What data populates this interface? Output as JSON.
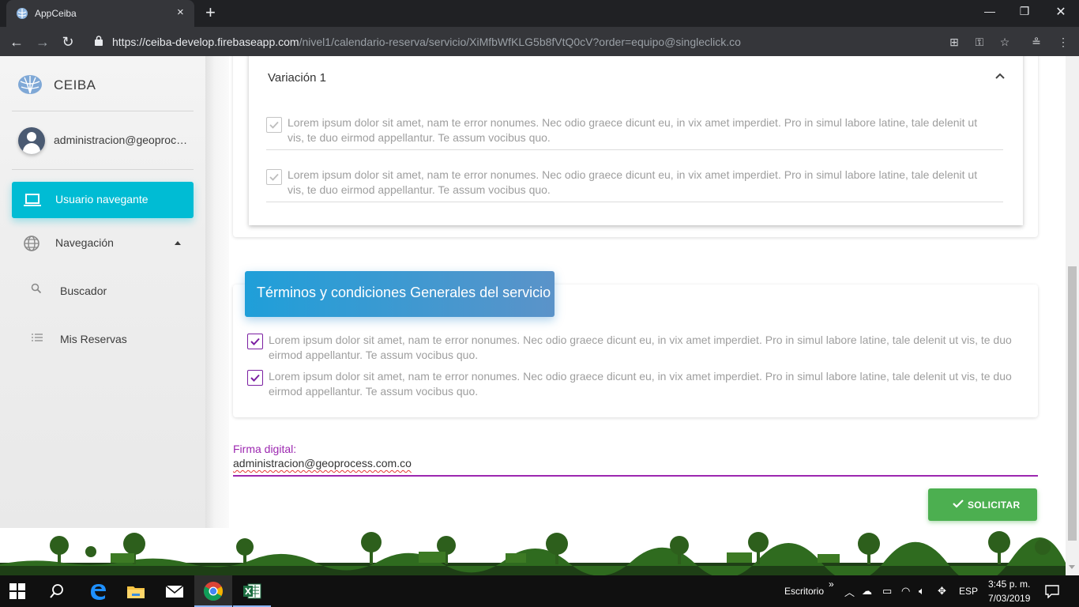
{
  "browser": {
    "tab_title": "AppCeiba",
    "tab_close": "×",
    "new_tab": "+",
    "url_host": "https://ceiba-develop.firebaseapp.com",
    "url_path": "/nivel1/calendario-reserva/servicio/XiMfbWfKLG5b8fVtQ0cV?order=equipo@singleclick.co"
  },
  "sidebar": {
    "brand": "CEIBA",
    "user_email": "administracion@geoprocess.com.co",
    "items": [
      {
        "label": "Usuario navegante",
        "icon": "laptop-icon"
      },
      {
        "label": "Navegación",
        "icon": "globe-icon"
      },
      {
        "label": "Buscador",
        "icon": "search-icon"
      },
      {
        "label": "Mis Reservas",
        "icon": "list-icon"
      }
    ]
  },
  "variation": {
    "title": "Variación 1",
    "items": [
      "Lorem ipsum dolor sit amet, nam te error nonumes. Nec odio graece dicunt eu, in vix amet imperdiet. Pro in simul labore latine, tale delenit ut vis, te duo eirmod appellantur. Te assum vocibus quo.",
      "Lorem ipsum dolor sit amet, nam te error nonumes. Nec odio graece dicunt eu, in vix amet imperdiet. Pro in simul labore latine, tale delenit ut vis, te duo eirmod appellantur. Te assum vocibus quo."
    ]
  },
  "terms": {
    "title": "Términos y condiciones Generales del servicio",
    "items": [
      "Lorem ipsum dolor sit amet, nam te error nonumes. Nec odio graece dicunt eu, in vix amet imperdiet. Pro in simul labore latine, tale delenit ut vis, te duo eirmod appellantur. Te assum vocibus quo.",
      "Lorem ipsum dolor sit amet, nam te error nonumes. Nec odio graece dicunt eu, in vix amet imperdiet. Pro in simul labore latine, tale delenit ut vis, te duo eirmod appellantur. Te assum vocibus quo."
    ]
  },
  "signature": {
    "label": "Firma digital:",
    "value": "administracion@geoprocess.com.co"
  },
  "actions": {
    "submit_label": "SOLICITAR"
  },
  "taskbar": {
    "desktop_label": "Escritorio",
    "chevron": "»",
    "language": "ESP",
    "time": "3:45 p. m.",
    "date": "7/03/2019"
  },
  "colors": {
    "accent_cyan": "#00bcd4",
    "terms_blue": "#1f9fd9",
    "signature_purple": "#9c27b0",
    "submit_green": "#4caf50"
  }
}
